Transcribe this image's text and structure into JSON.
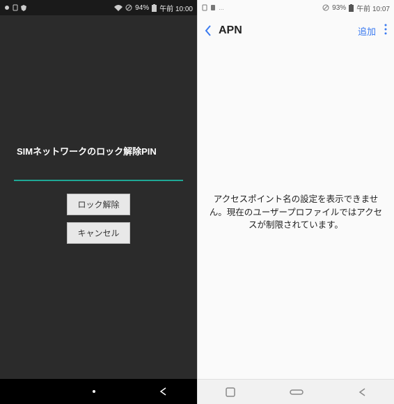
{
  "left": {
    "status": {
      "battery_pct": "94%",
      "time": "午前 10:00"
    },
    "sim_label": "SIMネットワークのロック解除PIN",
    "pin_value": "",
    "unlock_label": "ロック解除",
    "cancel_label": "キャンセル"
  },
  "right": {
    "status": {
      "battery_pct": "93%",
      "time": "午前 10:07"
    },
    "header": {
      "title": "APN",
      "add_label": "追加"
    },
    "message": "アクセスポイント名の設定を表示できません。現在のユーザープロファイルではアクセスが制限されています。"
  }
}
